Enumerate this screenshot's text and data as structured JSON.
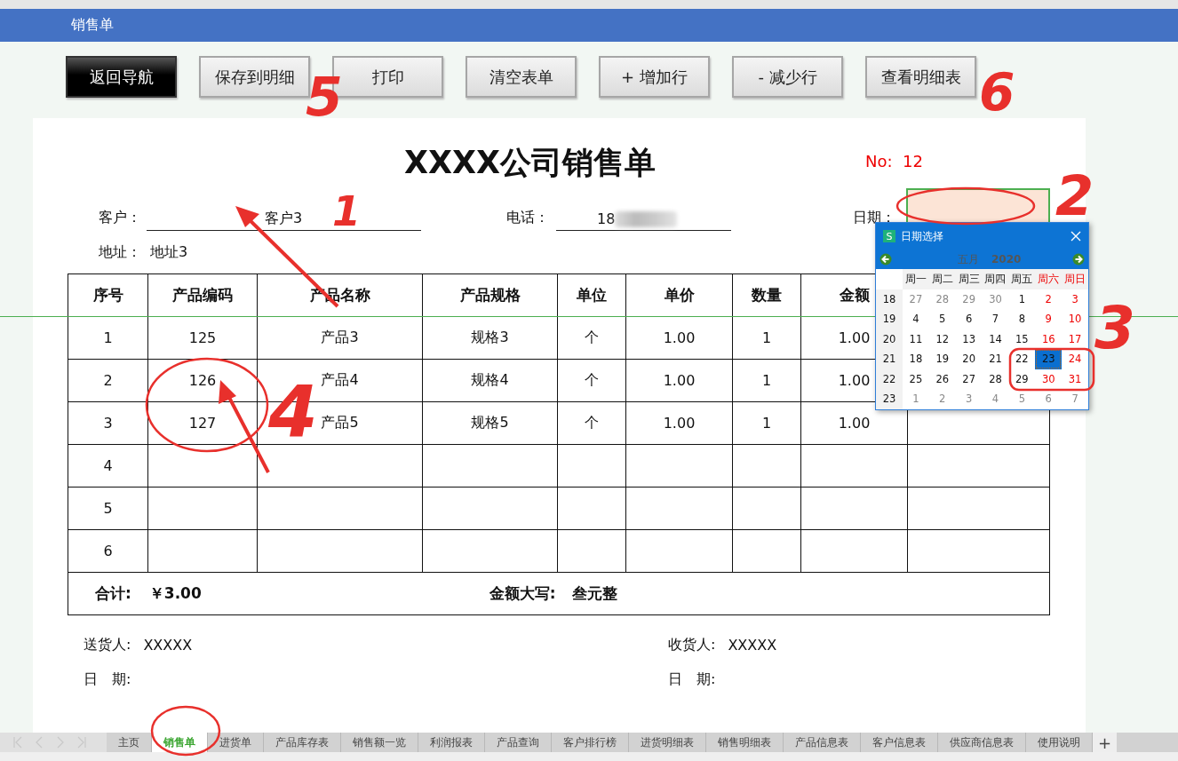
{
  "app_title": "销售单",
  "toolbar": [
    {
      "label": "返回导航",
      "kind": "primary"
    },
    {
      "label": "保存到明细",
      "kind": "normal"
    },
    {
      "label": "打印",
      "kind": "normal"
    },
    {
      "label": "清空表单",
      "kind": "normal"
    },
    {
      "label": "+ 增加行",
      "kind": "normal"
    },
    {
      "label": "- 减少行",
      "kind": "normal"
    },
    {
      "label": "查看明细表",
      "kind": "normal"
    }
  ],
  "form": {
    "title": "XXXX公司销售单",
    "number_label": "No:",
    "number": "12",
    "customer_label": "客户：",
    "customer": "客户3",
    "phone_label": "电话：",
    "phone": "18",
    "date_label": "日期：",
    "address_label": "地址：",
    "address": "地址3"
  },
  "table": {
    "columns": [
      "序号",
      "产品编码",
      "产品名称",
      "产品规格",
      "单位",
      "单价",
      "数量",
      "金额"
    ],
    "rows": [
      {
        "cells": [
          "1",
          "125",
          "产品3",
          "规格3",
          "个",
          "1.00",
          "1",
          "1.00"
        ]
      },
      {
        "cells": [
          "2",
          "126",
          "产品4",
          "规格4",
          "个",
          "1.00",
          "1",
          "1.00"
        ]
      },
      {
        "cells": [
          "3",
          "127",
          "产品5",
          "规格5",
          "个",
          "1.00",
          "1",
          "1.00"
        ]
      },
      {
        "cells": [
          "4"
        ]
      },
      {
        "cells": [
          "5"
        ]
      },
      {
        "cells": [
          "6"
        ]
      }
    ],
    "total_label": "合计:",
    "total": "￥3.00",
    "upper_label": "金额大写:",
    "upper": "叁元整"
  },
  "signatures": [
    {
      "label": "送货人:",
      "value": "XXXXX",
      "date_label": "日　期:"
    },
    {
      "label": "收货人:",
      "value": "XXXXX",
      "date_label": "日　期:"
    }
  ],
  "date_picker": {
    "app_icon": "S",
    "title": "日期选择",
    "month": "五月",
    "year": "2020",
    "weekdays": [
      {
        "text": "周一",
        "weekend": false
      },
      {
        "text": "周二",
        "weekend": false
      },
      {
        "text": "周三",
        "weekend": false
      },
      {
        "text": "周四",
        "weekend": false
      },
      {
        "text": "周五",
        "weekend": false
      },
      {
        "text": "周六",
        "weekend": true
      },
      {
        "text": "周日",
        "weekend": true
      }
    ],
    "weeks": [
      {
        "week": "18",
        "days": [
          {
            "text": "27",
            "kind": "other",
            "selected": false
          },
          {
            "text": "28",
            "kind": "other",
            "selected": false
          },
          {
            "text": "29",
            "kind": "other",
            "selected": false
          },
          {
            "text": "30",
            "kind": "other",
            "selected": false
          },
          {
            "text": "1",
            "kind": "normal",
            "selected": false
          },
          {
            "text": "2",
            "kind": "weekend",
            "selected": false
          },
          {
            "text": "3",
            "kind": "weekend",
            "selected": false
          }
        ]
      },
      {
        "week": "19",
        "days": [
          {
            "text": "4",
            "kind": "normal",
            "selected": false
          },
          {
            "text": "5",
            "kind": "normal",
            "selected": false
          },
          {
            "text": "6",
            "kind": "normal",
            "selected": false
          },
          {
            "text": "7",
            "kind": "normal",
            "selected": false
          },
          {
            "text": "8",
            "kind": "normal",
            "selected": false
          },
          {
            "text": "9",
            "kind": "weekend",
            "selected": false
          },
          {
            "text": "10",
            "kind": "weekend",
            "selected": false
          }
        ]
      },
      {
        "week": "20",
        "days": [
          {
            "text": "11",
            "kind": "normal",
            "selected": false
          },
          {
            "text": "12",
            "kind": "normal",
            "selected": false
          },
          {
            "text": "13",
            "kind": "normal",
            "selected": false
          },
          {
            "text": "14",
            "kind": "normal",
            "selected": false
          },
          {
            "text": "15",
            "kind": "normal",
            "selected": false
          },
          {
            "text": "16",
            "kind": "weekend",
            "selected": false
          },
          {
            "text": "17",
            "kind": "weekend",
            "selected": false
          }
        ]
      },
      {
        "week": "21",
        "days": [
          {
            "text": "18",
            "kind": "normal",
            "selected": false
          },
          {
            "text": "19",
            "kind": "normal",
            "selected": false
          },
          {
            "text": "20",
            "kind": "normal",
            "selected": false
          },
          {
            "text": "21",
            "kind": "normal",
            "selected": false
          },
          {
            "text": "22",
            "kind": "normal",
            "selected": false
          },
          {
            "text": "23",
            "kind": "weekend",
            "selected": true
          },
          {
            "text": "24",
            "kind": "weekend",
            "selected": false
          }
        ]
      },
      {
        "week": "22",
        "days": [
          {
            "text": "25",
            "kind": "normal",
            "selected": false
          },
          {
            "text": "26",
            "kind": "normal",
            "selected": false
          },
          {
            "text": "27",
            "kind": "normal",
            "selected": false
          },
          {
            "text": "28",
            "kind": "normal",
            "selected": false
          },
          {
            "text": "29",
            "kind": "normal",
            "selected": false
          },
          {
            "text": "30",
            "kind": "weekend",
            "selected": false
          },
          {
            "text": "31",
            "kind": "weekend",
            "selected": false
          }
        ]
      },
      {
        "week": "23",
        "days": [
          {
            "text": "1",
            "kind": "other",
            "selected": false
          },
          {
            "text": "2",
            "kind": "other",
            "selected": false
          },
          {
            "text": "3",
            "kind": "other",
            "selected": false
          },
          {
            "text": "4",
            "kind": "other",
            "selected": false
          },
          {
            "text": "5",
            "kind": "other",
            "selected": false
          },
          {
            "text": "6",
            "kind": "other",
            "selected": false
          },
          {
            "text": "7",
            "kind": "other",
            "selected": false
          }
        ]
      }
    ]
  },
  "sheet_tabs": [
    {
      "label": "主页",
      "selected": false
    },
    {
      "label": "销售单",
      "selected": true
    },
    {
      "label": "进货单",
      "selected": false
    },
    {
      "label": "产品库存表",
      "selected": false
    },
    {
      "label": "销售额一览",
      "selected": false
    },
    {
      "label": "利润报表",
      "selected": false
    },
    {
      "label": "产品查询",
      "selected": false
    },
    {
      "label": "客户排行榜",
      "selected": false
    },
    {
      "label": "进货明细表",
      "selected": false
    },
    {
      "label": "销售明细表",
      "selected": false
    },
    {
      "label": "产品信息表",
      "selected": false
    },
    {
      "label": "客户信息表",
      "selected": false
    },
    {
      "label": "供应商信息表",
      "selected": false
    },
    {
      "label": "使用说明",
      "selected": false
    }
  ],
  "add_sheet": "+",
  "annotations": [
    {
      "text": "1"
    },
    {
      "text": "2"
    },
    {
      "text": "3"
    },
    {
      "text": "4"
    },
    {
      "text": "5"
    },
    {
      "text": "6"
    }
  ]
}
